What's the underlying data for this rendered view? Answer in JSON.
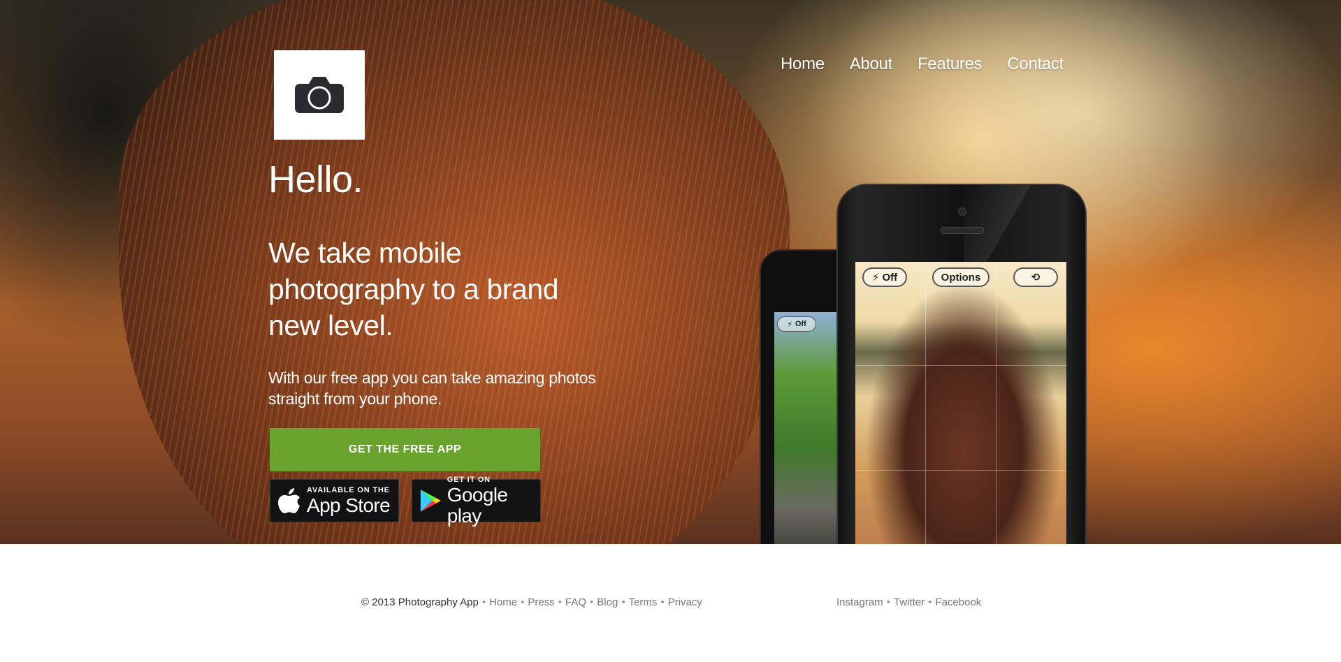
{
  "nav": {
    "items": [
      "Home",
      "About",
      "Features",
      "Contact"
    ]
  },
  "logo": {
    "icon": "camera-icon"
  },
  "hero": {
    "greeting": "Hello.",
    "tagline": "We take mobile photography to a brand new level.",
    "subtext": "With our free app you can take amazing photos straight from your phone.",
    "cta_label": "GET THE FREE APP"
  },
  "badges": {
    "apple": {
      "small": "AVAILABLE ON THE",
      "big": "App Store"
    },
    "google": {
      "small": "GET IT ON",
      "big": "Google play"
    }
  },
  "phone": {
    "flash_label": "Off",
    "options_label": "Options",
    "back_flash_label": "Off"
  },
  "footer": {
    "copyright": "© 2013 Photography App",
    "links": [
      "Home",
      "Press",
      "FAQ",
      "Blog",
      "Terms",
      "Privacy"
    ],
    "social": [
      "Instagram",
      "Twitter",
      "Facebook"
    ]
  },
  "colors": {
    "cta_green": "#6aa22e",
    "badge_black": "#121212",
    "footer_link": "#777777"
  }
}
